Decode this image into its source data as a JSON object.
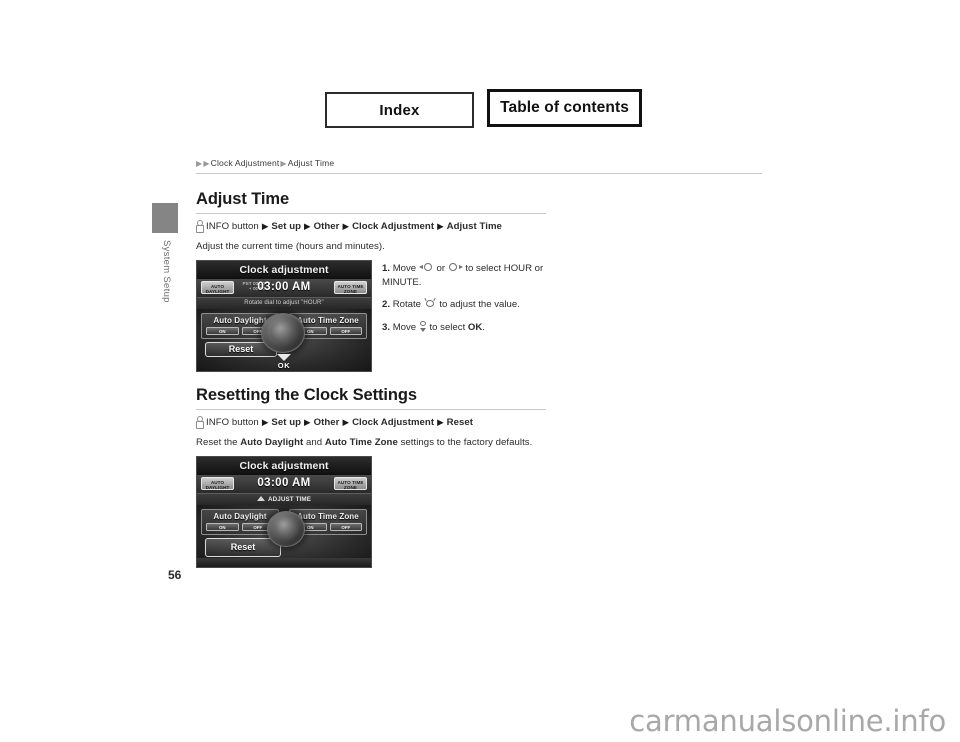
{
  "nav_buttons": {
    "index_label": "Index",
    "toc_label": "Table of contents"
  },
  "chapter": {
    "label": "System Setup"
  },
  "breadcrumb": {
    "item1": "Clock Adjustment",
    "item2": "Adjust Time"
  },
  "sections": [
    {
      "title": "Adjust Time",
      "path": {
        "button": "INFO button",
        "steps": [
          "Set up",
          "Other",
          "Clock Adjustment",
          "Adjust Time"
        ]
      },
      "intro": "Adjust the current time (hours and minutes).",
      "steps": [
        {
          "num": "1.",
          "text_before": "Move",
          "text_mid": "or",
          "text_after": "to select HOUR or MINUTE."
        },
        {
          "num": "2.",
          "text_before": "Rotate",
          "text_after": "to adjust the value."
        },
        {
          "num": "3.",
          "text_before": "Move",
          "text_after": "to select",
          "bold_target": "OK",
          "period": "."
        }
      ],
      "screen": {
        "title": "Clock adjustment",
        "left_chip": "AUTO DAYLIGHT",
        "right_chip": "AUTO TIME ZONE",
        "tz_line1": "PST 03:00",
        "tz_line2": "+ 00:00",
        "time": "03:00 AM",
        "hint": "Rotate dial to adjust \"HOUR\"",
        "left_panel_label": "Auto Daylight",
        "right_panel_label": "Auto Time Zone",
        "on_label": "ON",
        "off_label": "OFF",
        "reset_label": "Reset",
        "ok_label": "OK"
      }
    },
    {
      "title": "Resetting the Clock Settings",
      "path": {
        "button": "INFO button",
        "steps": [
          "Set up",
          "Other",
          "Clock Adjustment",
          "Reset"
        ]
      },
      "intro_parts": {
        "a": "Reset the ",
        "b": "Auto Daylight",
        "c": " and ",
        "d": "Auto Time Zone",
        "e": " settings to the factory defaults."
      },
      "screen": {
        "title": "Clock adjustment",
        "left_chip": "AUTO DAYLIGHT",
        "right_chip": "AUTO TIME ZONE",
        "time": "03:00 AM",
        "hint": "ADJUST TIME",
        "left_panel_label": "Auto Daylight",
        "right_panel_label": "Auto Time Zone",
        "on_label": "ON",
        "off_label": "OFF",
        "reset_label": "Reset"
      }
    }
  ],
  "page_number": "56",
  "watermark": "carmanualsonline.info"
}
